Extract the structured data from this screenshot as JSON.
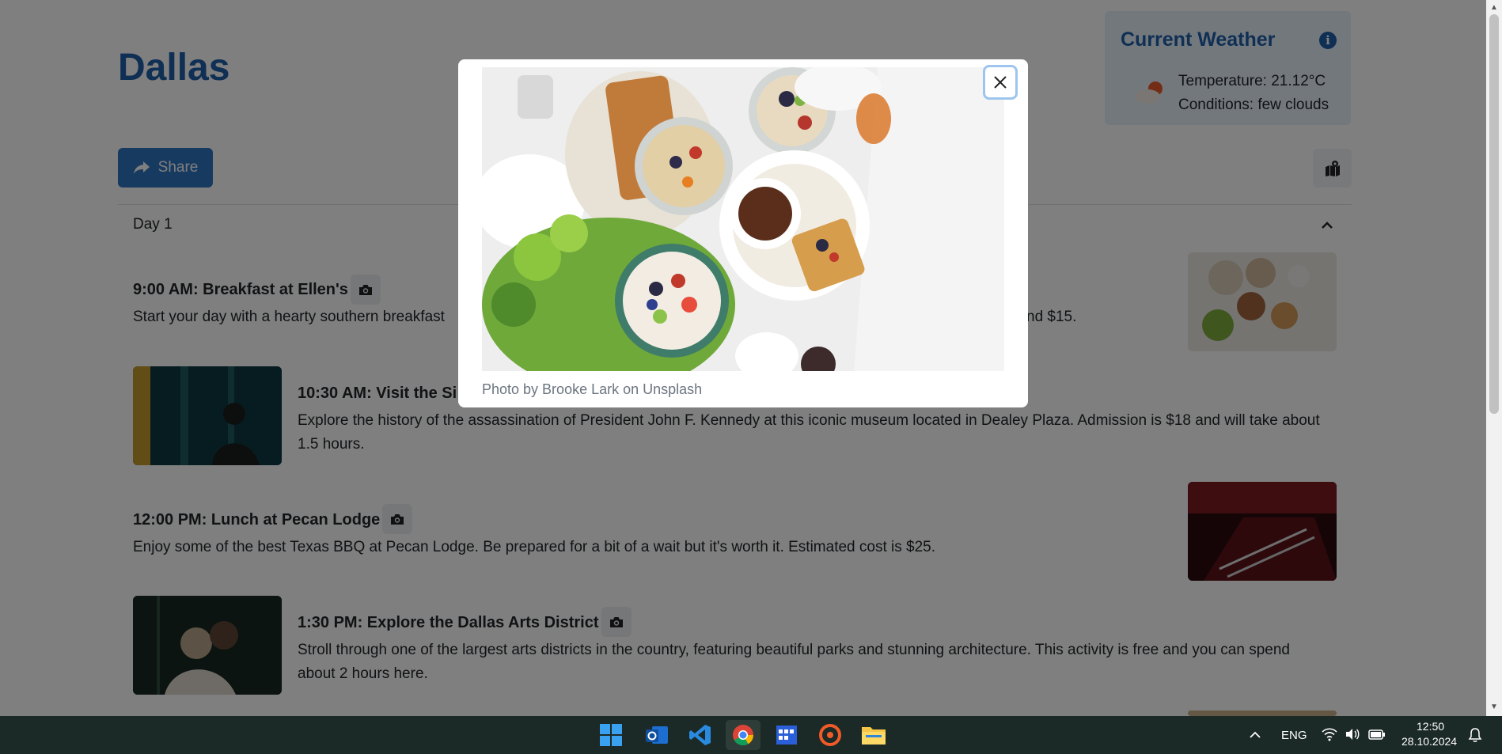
{
  "page": {
    "city": "Dallas",
    "share_label": "Share",
    "day_label": "Day 1"
  },
  "weather": {
    "title": "Current Weather",
    "temperature": "Temperature: 21.12°C",
    "conditions": "Conditions: few clouds"
  },
  "activities": [
    {
      "title": "9:00 AM: Breakfast at Ellen's",
      "desc": "Start your day with a hearty southern breakfast",
      "desc_tail": "nd $15."
    },
    {
      "title": "10:30 AM: Visit the Si",
      "desc": "Explore the history of the assassination of President John F. Kennedy at this iconic museum located in Dealey Plaza. Admission is $18 and will take about 1.5 hours."
    },
    {
      "title": "12:00 PM: Lunch at Pecan Lodge",
      "desc": "Enjoy some of the best Texas BBQ at Pecan Lodge. Be prepared for a bit of a wait but it's worth it. Estimated cost is $25."
    },
    {
      "title": "1:30 PM: Explore the Dallas Arts District",
      "desc": "Stroll through one of the largest arts districts in the country, featuring beautiful parks and stunning architecture. This activity is free and you can spend about 2 hours here."
    }
  ],
  "modal": {
    "caption": "Photo by Brooke Lark on Unsplash"
  },
  "taskbar": {
    "language": "ENG",
    "time": "12:50",
    "date": "28.10.2024"
  },
  "icons": [
    "share-icon",
    "map-icon",
    "info-icon",
    "weather-icon",
    "camera-icon",
    "chevron-up-icon",
    "close-icon",
    "windows-start-icon",
    "outlook-icon",
    "vscode-icon",
    "chrome-icon",
    "calendar-app-icon",
    "git-icon",
    "file-explorer-icon",
    "wifi-icon",
    "volume-icon",
    "battery-icon",
    "notification-icon"
  ],
  "colors": {
    "accent": "#1f5fa8",
    "button": "#2f74c0",
    "weather_bg": "#e7f1fb",
    "taskbar": "#1b2a26"
  }
}
